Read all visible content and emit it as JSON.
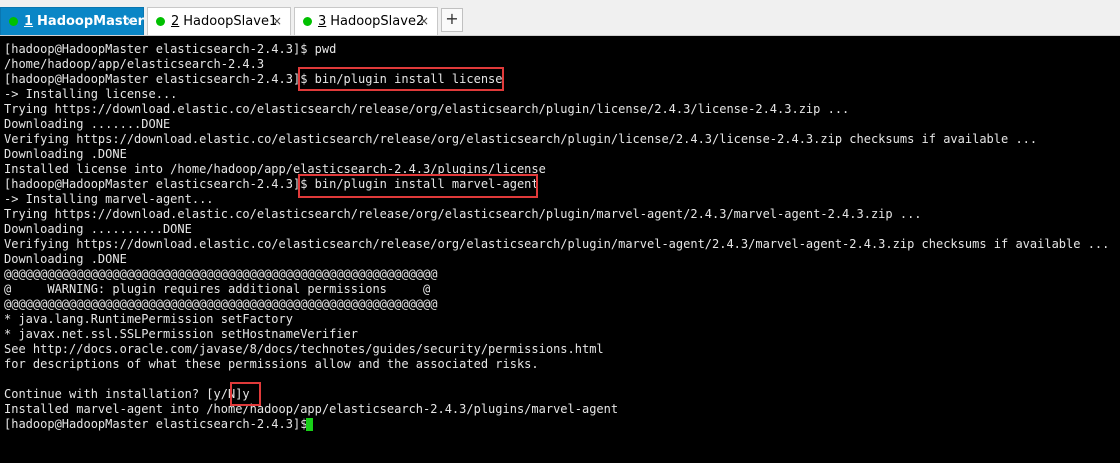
{
  "tabs": [
    {
      "index": "1",
      "label": "HadoopMaster",
      "active": true,
      "close": "×"
    },
    {
      "index": "2",
      "label": "HadoopSlave1",
      "active": false,
      "close": "×"
    },
    {
      "index": "3",
      "label": "HadoopSlave2",
      "active": false,
      "close": "×"
    }
  ],
  "add_tab_label": "+",
  "status_color": "#00c000",
  "terminal": {
    "lines": [
      "[hadoop@HadoopMaster elasticsearch-2.4.3]$ pwd",
      "/home/hadoop/app/elasticsearch-2.4.3",
      "[hadoop@HadoopMaster elasticsearch-2.4.3]$ bin/plugin install license",
      "-> Installing license...",
      "Trying https://download.elastic.co/elasticsearch/release/org/elasticsearch/plugin/license/2.4.3/license-2.4.3.zip ...",
      "Downloading .......DONE",
      "Verifying https://download.elastic.co/elasticsearch/release/org/elasticsearch/plugin/license/2.4.3/license-2.4.3.zip checksums if available ...",
      "Downloading .DONE",
      "Installed license into /home/hadoop/app/elasticsearch-2.4.3/plugins/license",
      "[hadoop@HadoopMaster elasticsearch-2.4.3]$ bin/plugin install marvel-agent",
      "-> Installing marvel-agent...",
      "Trying https://download.elastic.co/elasticsearch/release/org/elasticsearch/plugin/marvel-agent/2.4.3/marvel-agent-2.4.3.zip ...",
      "Downloading ..........DONE",
      "Verifying https://download.elastic.co/elasticsearch/release/org/elasticsearch/plugin/marvel-agent/2.4.3/marvel-agent-2.4.3.zip checksums if available ...",
      "Downloading .DONE",
      "@@@@@@@@@@@@@@@@@@@@@@@@@@@@@@@@@@@@@@@@@@@@@@@@@@@@@@@@@@@@",
      "@     WARNING: plugin requires additional permissions     @",
      "@@@@@@@@@@@@@@@@@@@@@@@@@@@@@@@@@@@@@@@@@@@@@@@@@@@@@@@@@@@@",
      "* java.lang.RuntimePermission setFactory",
      "* javax.net.ssl.SSLPermission setHostnameVerifier",
      "See http://docs.oracle.com/javase/8/docs/technotes/guides/security/permissions.html",
      "for descriptions of what these permissions allow and the associated risks.",
      "",
      "Continue with installation? [y/N]y",
      "Installed marvel-agent into /home/hadoop/app/elasticsearch-2.4.3/plugins/marvel-agent",
      "[hadoop@HadoopMaster elasticsearch-2.4.3]$ "
    ],
    "highlight_color": "#e03a3a",
    "cursor_color": "#18d018"
  }
}
